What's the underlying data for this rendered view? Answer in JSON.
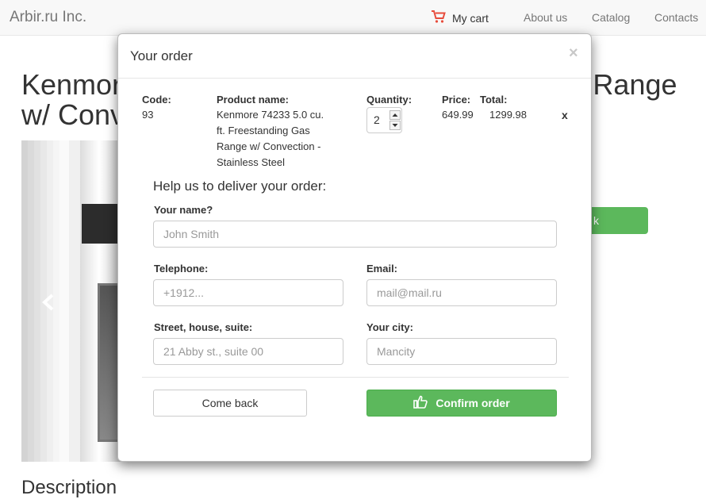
{
  "navbar": {
    "brand": "Arbir.ru Inc.",
    "cart_label": "My cart",
    "links": [
      "About us",
      "Catalog",
      "Contacts"
    ],
    "cart_icon": "shopping-cart-icon",
    "cart_icon_color": "#e74c3c"
  },
  "page": {
    "title": "Kenmore 74233 5.0 cu. ft. Freestanding Gas Range w/ Convection",
    "description_heading": "Description",
    "behind_button_fragment": "k"
  },
  "modal": {
    "title": "Your order",
    "close": "×",
    "columns": {
      "code": "Code:",
      "product": "Product name:",
      "quantity": "Quantity:",
      "price": "Price:",
      "total": "Total:"
    },
    "item": {
      "code": "93",
      "product_lines": [
        "Kenmore 74233 5.0 cu.",
        "ft. Freestanding Gas",
        "Range w/ Convection -",
        "Stainless Steel"
      ],
      "quantity": "2",
      "price": "649.99",
      "total": "1299.98",
      "remove": "x"
    },
    "form": {
      "heading": "Help us to deliver your order:",
      "name_label": "Your name?",
      "name_placeholder": "John Smith",
      "phone_label": "Telephone:",
      "phone_placeholder": "+1912...",
      "email_label": "Email:",
      "email_placeholder": "mail@mail.ru",
      "street_label": "Street, house, suite:",
      "street_placeholder": "21 Abby st., suite 00",
      "city_label": "Your city:",
      "city_placeholder": "Mancity"
    },
    "buttons": {
      "back": "Come back",
      "confirm": "Confirm order"
    },
    "accent_color": "#5cb85c"
  }
}
